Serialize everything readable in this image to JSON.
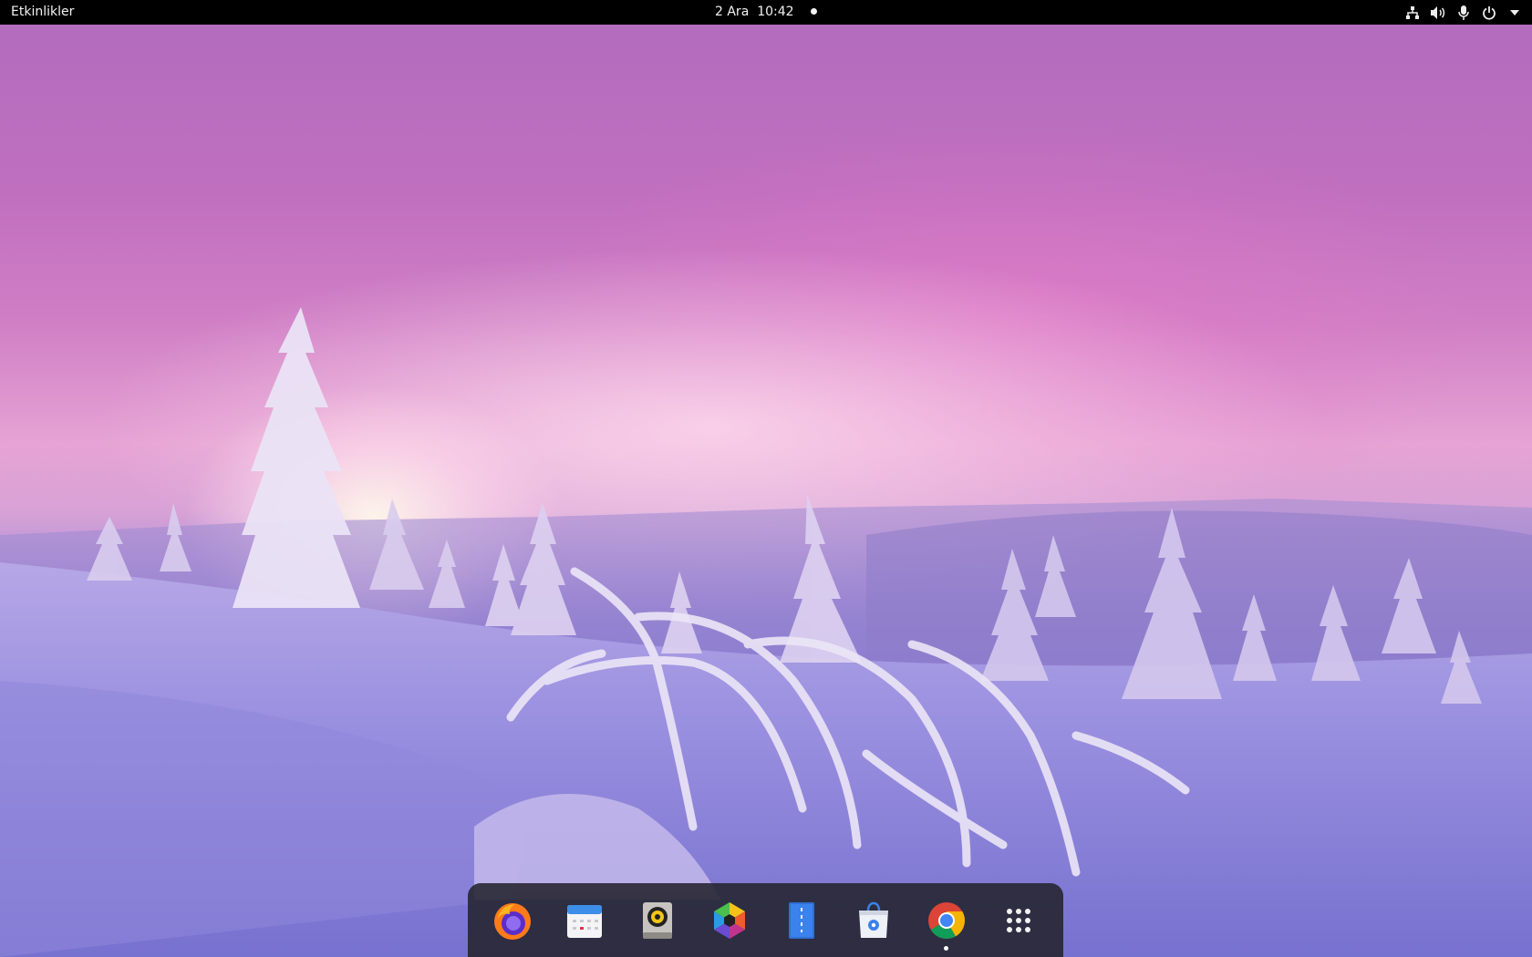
{
  "topbar": {
    "activities_label": "Etkinlikler",
    "date": "2 Ara",
    "time": "10:42",
    "tray_icons": [
      "network-icon",
      "volume-icon",
      "microphone-icon",
      "power-icon",
      "chevron-down-icon"
    ]
  },
  "wallpaper": {
    "description": "snowy forest at sunset",
    "colors": {
      "sky_top": "#b36cbe",
      "sky_glow": "#f4c3de",
      "snow": "#8f87dc"
    }
  },
  "dock": {
    "items": [
      {
        "app": "Firefox",
        "icon": "firefox-icon",
        "running": false
      },
      {
        "app": "Calendar",
        "icon": "calendar-icon",
        "running": false
      },
      {
        "app": "Rhythmbox",
        "icon": "speaker-icon",
        "running": false
      },
      {
        "app": "Photos",
        "icon": "photos-icon",
        "running": false
      },
      {
        "app": "Document Viewer",
        "icon": "document-viewer-icon",
        "running": false
      },
      {
        "app": "Software",
        "icon": "software-icon",
        "running": false
      },
      {
        "app": "Chrome",
        "icon": "chrome-icon",
        "running": true
      },
      {
        "app": "Show Applications",
        "icon": "app-grid-icon",
        "running": false
      }
    ]
  }
}
